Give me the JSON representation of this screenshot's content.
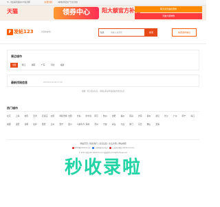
{
  "topbar": {
    "greeting": "Hi，欢迎来到发帖123信息网",
    "login": "[免费注册]",
    "tabs": "[本地][附近][广告][分类]"
  },
  "banner": {
    "tmall": "天猫",
    "coupon": "领券中心",
    "sale": "阳大额官方补贴",
    "tag1": "每天领天猫优惠券",
    "tag2": "天猫大额神券"
  },
  "header": {
    "logo_badge": "F",
    "logo_text": "发帖123",
    "city_switch": "[切换城市]",
    "search_category": "信息",
    "search_placeholder": "请输入关键字",
    "search_button": "搜索",
    "post_button": "免费发布信息"
  },
  "nearby": {
    "title": "周边城市",
    "chips": [
      "全国",
      "浙江",
      "湖南",
      "广东",
      "河北",
      "福建"
    ]
  },
  "latest": {
    "title": "最新找陪信息",
    "subtitle": "2024-04-20 00:17:40",
    "empty": "抱歉！暂无相关信息，请稍后再来查看或发布您的信息"
  },
  "hot": {
    "title": "热门城市",
    "rows": [
      [
        "北京",
        "上海",
        "重庆",
        "天津",
        "石家庄",
        "太原",
        "呼和浩特",
        "沈阳",
        "长春",
        "哈尔滨",
        "南京",
        "杭州",
        "合肥",
        "福州",
        "南昌",
        "济南",
        "郑州",
        "武汉",
        "长沙",
        "广州",
        "南宁",
        "海口"
      ],
      [
        "成都",
        "贵阳",
        "昆明",
        "拉萨",
        "西安",
        "兰州",
        "西宁",
        "银川",
        "乌鲁木齐",
        "深圳",
        "苏州",
        "宁波",
        "青岛",
        "大连",
        "厦门",
        "东莞",
        "佛山",
        "无锡"
      ]
    ]
  },
  "footer": {
    "links": "网站首页 | 联系我们 | 意见反馈 | 免责声明 | 网站地图",
    "icp": "粤ICP备1900xxxx号",
    "police": "工商网监电子标识",
    "record": "公安机关备案 4419xxxxxxxx",
    "copyright": "© 2024 发帖123 fatie123.com 版权所有 All Rights Reserved."
  },
  "slogan": "秒收录啦"
}
